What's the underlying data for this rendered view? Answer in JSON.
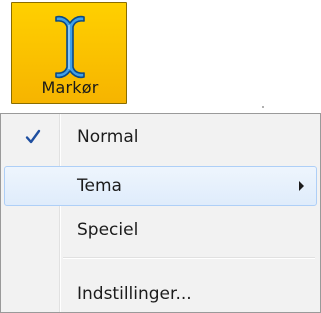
{
  "button": {
    "label": "Markør",
    "icon": "text-cursor-icon",
    "accent_color": "#f8be00"
  },
  "menu": {
    "items": [
      {
        "label": "Normal",
        "checked": true
      },
      {
        "label": "Tema",
        "has_submenu": true,
        "highlighted": true
      },
      {
        "label": "Speciel"
      },
      {
        "label": "Indstillinger..."
      }
    ]
  }
}
